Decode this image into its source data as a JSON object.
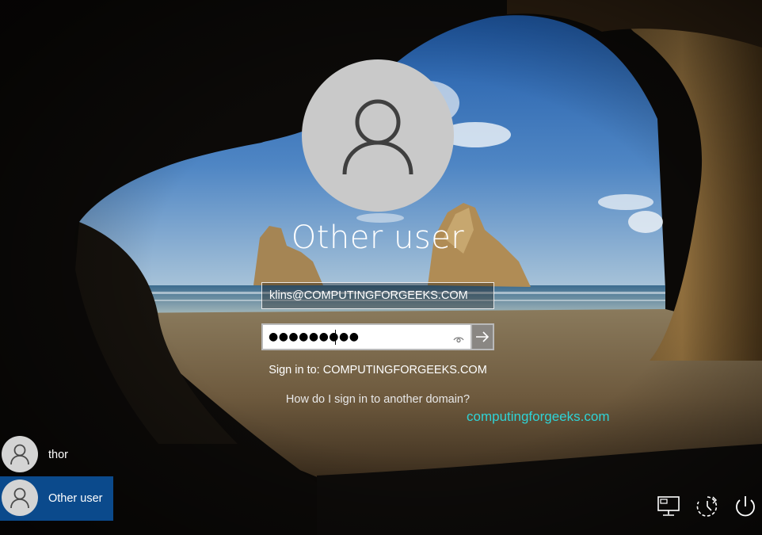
{
  "login": {
    "display_name": "Other user",
    "username_value": "klins@COMPUTINGFORGEEKS.COM",
    "password_mask": "●●●●●●●●●",
    "sign_in_to": "Sign in to: COMPUTINGFORGEEKS.COM",
    "another_domain_link": "How do I sign in to another domain?"
  },
  "watermark": "computingforgeeks.com",
  "users": [
    {
      "name": "thor",
      "selected": false
    },
    {
      "name": "Other user",
      "selected": true
    }
  ],
  "icons": {
    "avatar": "user-silhouette-icon",
    "reveal": "eye-icon",
    "submit": "arrow-right-icon",
    "network": "network-icon",
    "ease_of_access": "ease-of-access-icon",
    "power": "power-icon"
  },
  "colors": {
    "selected_tile": "#0b4a8c",
    "watermark": "#2fd3d6",
    "avatar_bg": "#c9c9c9"
  }
}
